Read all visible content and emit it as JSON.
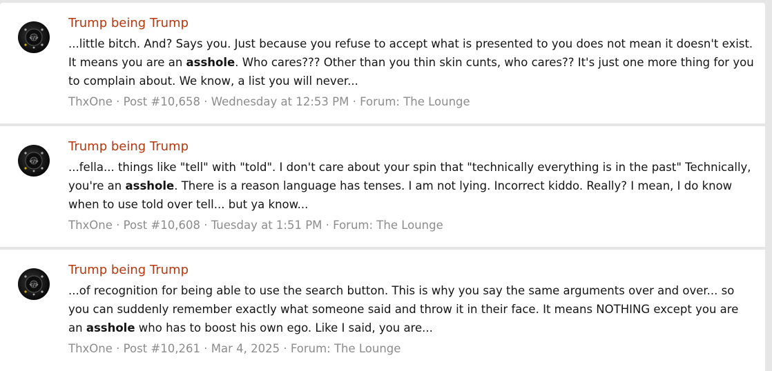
{
  "results": [
    {
      "title": "Trump being Trump",
      "snippet_before": "...little bitch. And? Says you. Just because you refuse to accept what is presented to you does not mean it doesn't exist. It means you are an ",
      "highlight": "asshole",
      "snippet_after": ". Who cares??? Other than you thin skin cunts, who cares?? It's just one more thing for you to complain about. We know, a list you will never...",
      "author": "ThxOne",
      "post_number": "Post #10,658",
      "date": "Wednesday at 12:53 PM",
      "forum": "Forum: The Lounge"
    },
    {
      "title": "Trump being Trump",
      "snippet_before": "...fella... things like \"tell\" with \"told\". I don't care about your spin that \"technically everything is in the past\" Technically, you're an ",
      "highlight": "asshole",
      "snippet_after": ". There is a reason language has tenses. I am not lying. Incorrect kiddo. Really? I mean, I do know when to use told over tell... but ya know...",
      "author": "ThxOne",
      "post_number": "Post #10,608",
      "date": "Tuesday at 1:51 PM",
      "forum": "Forum: The Lounge"
    },
    {
      "title": "Trump being Trump",
      "snippet_before": "...of recognition for being able to use the search button. This is why you say the same arguments over and over... so you can suddenly remember exactly what someone said and throw it in their face. It means NOTHING except you are an ",
      "highlight": "asshole",
      "snippet_after": " who has to boost his own ego. Like I said, you are...",
      "author": "ThxOne",
      "post_number": "Post #10,261",
      "date": "Mar 4, 2025",
      "forum": "Forum: The Lounge"
    }
  ],
  "separator": " · ",
  "colors": {
    "title": "#b5380e",
    "meta": "#8c8c8c",
    "text": "#141414",
    "background": "#e6e6e6"
  },
  "icons": {
    "avatar": "black-speaker-driver-avatar"
  }
}
